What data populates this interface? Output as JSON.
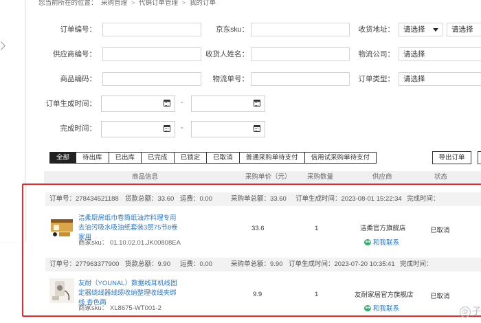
{
  "breadcrumb": {
    "prefix": "您当前所在的位置：",
    "items": [
      "采购管理",
      "代销订单管理",
      "我的订单"
    ]
  },
  "filters": {
    "order_no_label": "订单编号：",
    "jd_sku_label": "京东sku：",
    "address_label": "收货地址：",
    "address_select1": "请选择",
    "address_select2": "请选择",
    "supplier_no_label": "供应商编号：",
    "receiver_label": "收货人姓名：",
    "logistics_company_label": "物流公司：",
    "logistics_company_select": "请选择",
    "goods_code_label": "商品编码：",
    "logistics_no_label": "物流单号：",
    "order_type_label": "订单类型：",
    "order_type_select": "请选择",
    "created_time_label": "订单生成时间：",
    "completed_time_label": "完成时间：",
    "date_sep": "-"
  },
  "tabs": [
    "全部",
    "待出库",
    "已出库",
    "已完成",
    "已锁定",
    "已取消",
    "普通采购单待支付",
    "信用试采购单待支付"
  ],
  "export_label": "导出订单",
  "table_headers": [
    "商品信息",
    "采购单价（元）",
    "采购数量",
    "供应商",
    "状态"
  ],
  "orders": [
    {
      "order_no": "订单号：278434521188",
      "goods_total": "货款总额：33.60",
      "freight": "运费：0.00",
      "purchase_total": "采购单总额：33.60",
      "created": "订单生成时间：2023-08-01 15:22:34",
      "completed": "完成时间：",
      "title": "洁柔厨房纸巾卷筒纸油炸料理专用去油污吸水吸油纸套装3层75节8卷家用",
      "sku": "商家sku：  01.10.02.01.JK00808EA",
      "price": "33.6",
      "qty": "1",
      "supplier": "洁柔官方旗舰店",
      "contact": "和我联系",
      "status": "已取消"
    },
    {
      "order_no": "订单号：277963377900",
      "goods_total": "货款总额：9.90",
      "freight": "运费：0.00",
      "purchase_total": "采购单总额：9.90",
      "created": "订单生成时间：2023-07-20 10:35:41",
      "completed": "完成时间：",
      "title": "友耐（YOUNAL）数据线耳机线固定器绕线器线缆收纳整理收线夹绑线 杏色两",
      "sku": "商家sku：  XL8675-WT001-2",
      "price": "9.9",
      "qty": "1",
      "supplier": "友耐家居官方旗舰店",
      "contact": "和我联系",
      "status": "已取消"
    }
  ],
  "watermark": "子",
  "colors": {
    "highlight": "#e42a2a",
    "link": "#2a78c8",
    "contact": "#25b36a"
  }
}
